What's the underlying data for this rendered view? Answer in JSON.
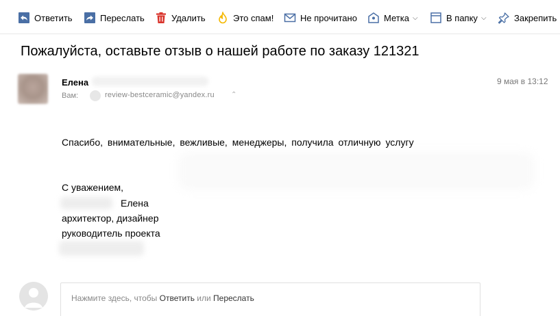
{
  "toolbar": {
    "reply_label": "Ответить",
    "forward_label": "Переслать",
    "delete_label": "Удалить",
    "spam_label": "Это спам!",
    "unread_label": "Не прочитано",
    "label_label": "Метка",
    "folder_label": "В папку",
    "pin_label": "Закрепить"
  },
  "icons": {
    "reply": "reply-icon",
    "forward": "forward-icon",
    "delete": "trash-icon",
    "spam": "flame-icon",
    "unread": "envelope-icon",
    "label": "tag-icon",
    "folder": "folder-icon",
    "pin": "pin-icon"
  },
  "colors": {
    "accent": "#4a6fa5",
    "delete": "#d9332b",
    "spam": "#f5b800"
  },
  "message": {
    "subject": "Пожалуйста, оставьте отзыв о нашей работе по заказу 121321",
    "sender_name": "Елена",
    "to_label": "Вам:",
    "to_email": "review-bestceramic@yandex.ru",
    "date": "9 мая в 13:12",
    "body": {
      "line1": "Спасибо, внимательные, вежливые, менеджеры, получила отличную услугу",
      "line2": "С уважением,",
      "line3": "Елена",
      "line4": "архитектор, дизайнер",
      "line5": "руководитель проекта"
    }
  },
  "reply": {
    "prefix": "Нажмите здесь, чтобы ",
    "reply_link": "Ответить",
    "middle": " или ",
    "forward_link": "Переслать"
  }
}
